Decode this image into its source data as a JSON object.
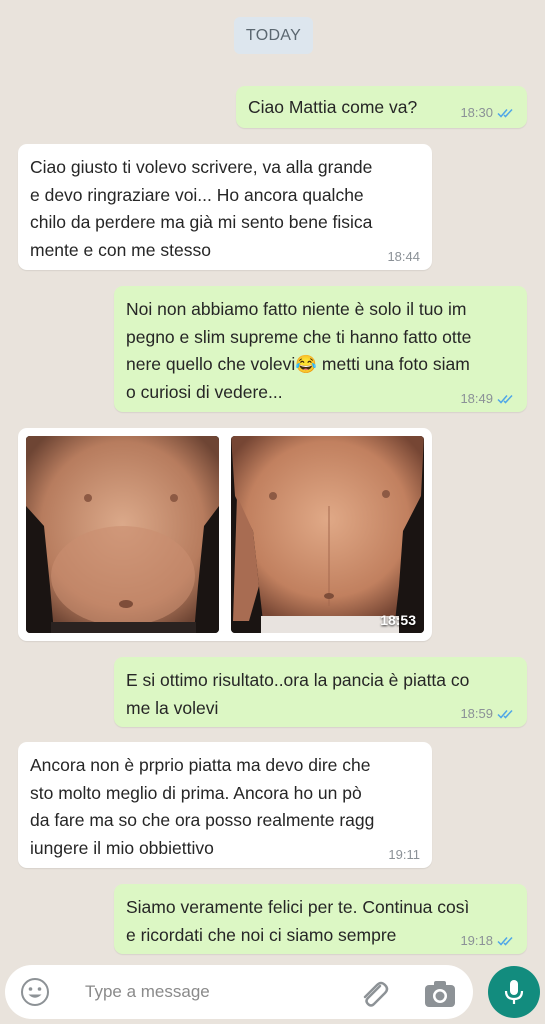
{
  "day_label": "TODAY",
  "messages": [
    {
      "direction": "out",
      "text": "Ciao Mattia come va?",
      "time": "18:30"
    },
    {
      "direction": "in",
      "text": "Ciao giusto ti volevo scrivere, va alla grande\ne devo ringraziare voi... Ho ancora qualche\nchilo da perdere ma già mi sento bene fisica\nmente e con me stesso",
      "time": "18:44"
    },
    {
      "direction": "out",
      "text": "Noi non abbiamo fatto niente è solo il tuo im\npegno e slim supreme che ti hanno fatto otte\nnere quello che volevi😂 metti una foto siam\no curiosi di vedere...",
      "time": "18:49"
    },
    {
      "direction": "in",
      "type": "photos",
      "time": "18:53"
    },
    {
      "direction": "out",
      "text": "E si ottimo risultato..ora la pancia è piatta co\nme la volevi",
      "time": "18:59"
    },
    {
      "direction": "in",
      "text": "Ancora non è prprio piatta ma devo dire che\nsto molto meglio di prima. Ancora ho un pò\nda fare ma so che ora posso realmente ragg\niungere il mio obbiettivo",
      "time": "19:11"
    },
    {
      "direction": "out",
      "text": "Siamo veramente felici per te. Continua così\ne ricordati che noi ci siamo sempre",
      "time": "19:18"
    }
  ],
  "composer": {
    "placeholder": "Type a message",
    "value": ""
  },
  "icons": {
    "emoji": "emoji-icon",
    "attach": "paperclip-icon",
    "camera": "camera-icon",
    "mic": "microphone-icon",
    "read_receipt": "double-check-icon"
  },
  "colors": {
    "outgoing_bubble": "#dcf7c4",
    "incoming_bubble": "#ffffff",
    "background": "#e9e3dc",
    "read_ticks": "#4fa6e8",
    "mic_button": "#128c7e"
  }
}
